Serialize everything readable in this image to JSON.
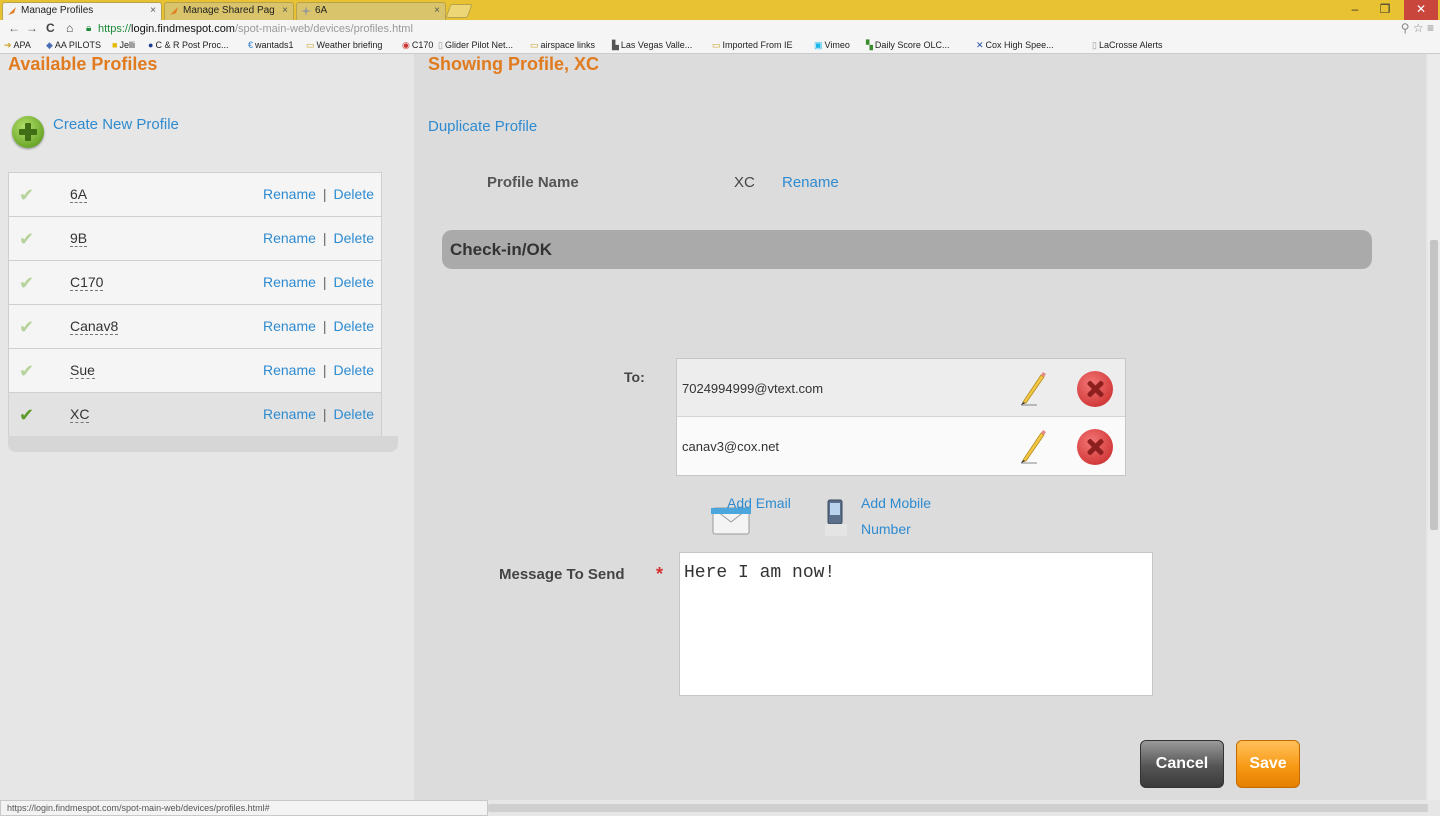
{
  "browser": {
    "tabs": [
      {
        "label": "Manage Profiles",
        "active": true
      },
      {
        "label": "Manage Shared Pag",
        "active": false
      },
      {
        "label": "6A",
        "active": false
      }
    ],
    "url": {
      "scheme": "https://",
      "host": "login.findmespot.com",
      "path": "/spot-main-web/devices/profiles.html"
    },
    "bookmarks": [
      "APA",
      "AA PILOTS",
      "Jelli",
      "C & R Post Proc...",
      "wantads1",
      "Weather briefing",
      "C170",
      "Glider Pilot Net...",
      "airspace links",
      "Las Vegas Valle...",
      "Imported From IE",
      "Vimeo",
      "Daily Score OLC...",
      "Cox High Spee...",
      "LaCrosse Alerts"
    ],
    "status_url": "https://login.findmespot.com/spot-main-web/devices/profiles.html#"
  },
  "sidebar": {
    "title": "Available Profiles",
    "create_label": "Create New Profile",
    "rename_label": "Rename",
    "delete_label": "Delete",
    "separator": "|",
    "profiles": [
      {
        "name": "6A",
        "selected": false
      },
      {
        "name": "9B",
        "selected": false
      },
      {
        "name": "C170",
        "selected": false
      },
      {
        "name": "Canav8",
        "selected": false
      },
      {
        "name": "Sue",
        "selected": false
      },
      {
        "name": "XC",
        "selected": true
      }
    ]
  },
  "main": {
    "title": "Showing Profile, XC",
    "duplicate_label": "Duplicate Profile",
    "profile_name_label": "Profile Name",
    "profile_name_value": "XC",
    "rename_label": "Rename",
    "section_title": "Check-in/OK",
    "to_label": "To:",
    "recipients": [
      "7024994999@vtext.com",
      "canav3@cox.net"
    ],
    "add_email_label": "Add Email",
    "add_mobile_line1": "Add Mobile",
    "add_mobile_line2": "Number",
    "message_label": "Message To Send",
    "required_mark": "*",
    "message_value": "Here I am now!",
    "cancel_label": "Cancel",
    "save_label": "Save"
  },
  "colors": {
    "accent_orange": "#e07b1f",
    "link_blue": "#2e8bd0",
    "save_orange": "#f89a16",
    "delete_red": "#d43c3c",
    "check_green": "#5e9a2c"
  }
}
